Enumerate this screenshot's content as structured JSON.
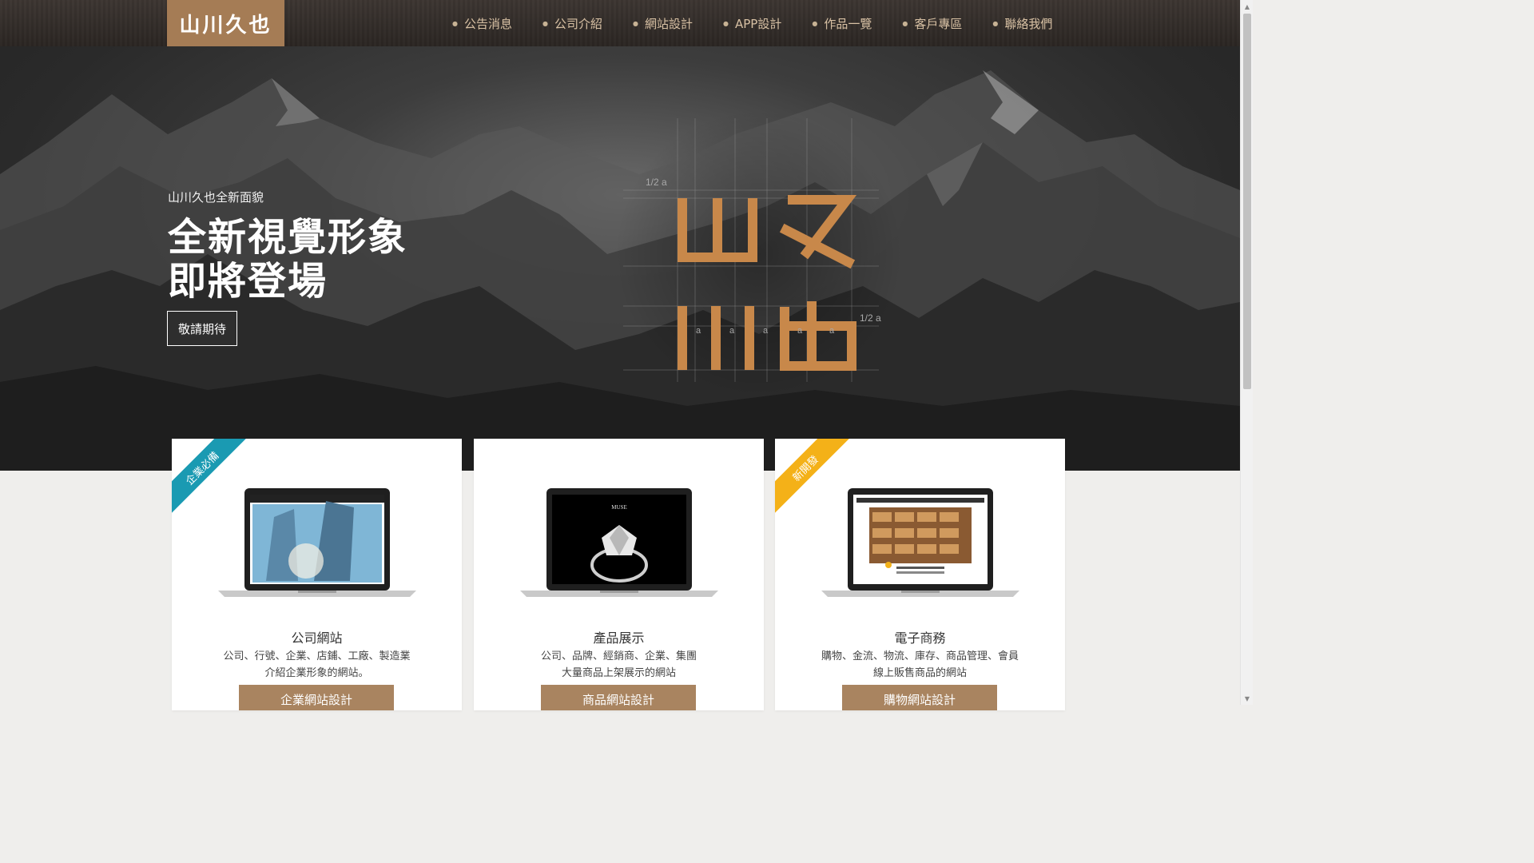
{
  "header": {
    "logo_text": "山川久也",
    "nav": [
      {
        "label": "公告消息"
      },
      {
        "label": "公司介紹"
      },
      {
        "label": "網站設計"
      },
      {
        "label": "APP設計"
      },
      {
        "label": "作品一覽"
      },
      {
        "label": "客戶專區"
      },
      {
        "label": "聯絡我們"
      }
    ]
  },
  "hero": {
    "subtitle": "山川久也全新面貌",
    "title_line1": "全新視覺形象",
    "title_line2": "即將登場",
    "button_label": "敬請期待",
    "art": {
      "glyphs": "山久川也",
      "measure_top": "1/2 a",
      "measure_right": "1/2 a",
      "measure_unit": "a"
    }
  },
  "cards": [
    {
      "ribbon": "企業必備",
      "title": "公司網站",
      "desc_line1": "公司、行號、企業、店鋪、工廠、製造業",
      "desc_line2": "介紹企業形象的網站。",
      "button_label": "企業網站設計"
    },
    {
      "ribbon": "",
      "title": "產品展示",
      "desc_line1": "公司、品牌、經銷商、企業、集團",
      "desc_line2": "大量商品上架展示的網站",
      "button_label": "商品網站設計",
      "screen_brand": "MUSE"
    },
    {
      "ribbon": "新開發",
      "title": "電子商務",
      "desc_line1": "購物、金流、物流、庫存、商品管理、會員",
      "desc_line2": "線上販售商品的網站",
      "button_label": "購物網站設計"
    }
  ],
  "colors": {
    "brand_brown": "#a57c55",
    "nav_text": "#d8c1a4",
    "ribbon_teal": "#1a9ab2",
    "ribbon_yellow": "#f4b118",
    "art_gold": "#c8884a"
  }
}
